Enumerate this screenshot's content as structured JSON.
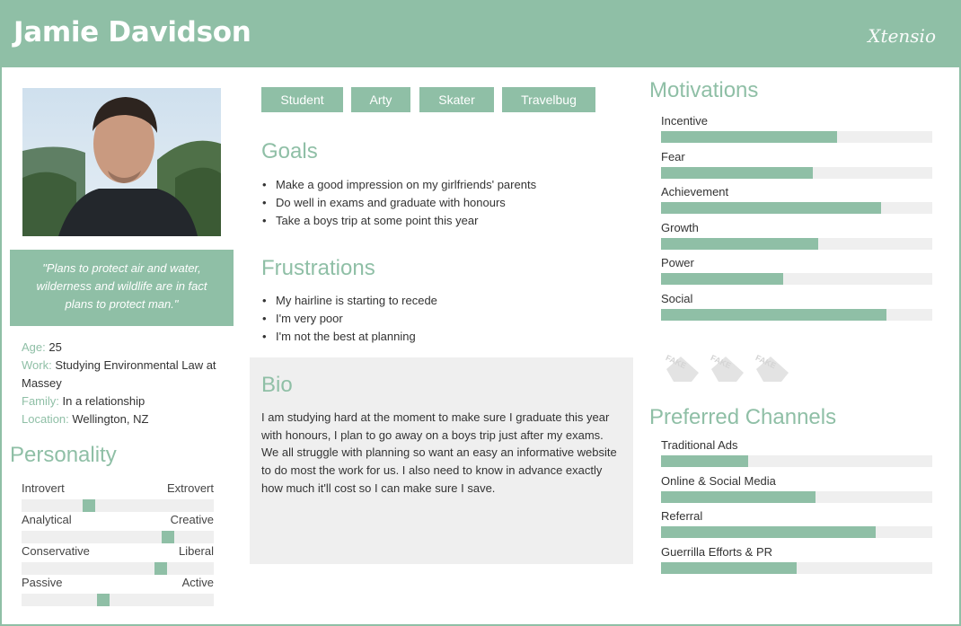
{
  "header": {
    "name": "Jamie Davidson",
    "brand": "Xtensio"
  },
  "quote": "\"Plans to protect air and water, wilderness and wildlife are in fact plans to protect man.\"",
  "facts": [
    {
      "key": "Age:",
      "value": " 25"
    },
    {
      "key": "Work:",
      "value": " Studying Environmental Law at Massey"
    },
    {
      "key": "Family:",
      "value": " In a relationship"
    },
    {
      "key": "Location:",
      "value": " Wellington, NZ"
    }
  ],
  "personality": {
    "title": "Personality",
    "traits": [
      {
        "left": "Introvert",
        "right": "Extrovert",
        "level": 0.34
      },
      {
        "left": "Analytical",
        "right": "Creative",
        "level": 0.78
      },
      {
        "left": "Conservative",
        "right": "Liberal",
        "level": 0.74
      },
      {
        "left": "Passive",
        "right": "Active",
        "level": 0.42
      }
    ]
  },
  "tags": [
    "Student",
    "Arty",
    "Skater",
    "Travelbug"
  ],
  "goals": {
    "title": "Goals",
    "items": [
      "Make a good impression on my girlfriends' parents",
      "Do well in exams and graduate with honours",
      "Take a boys trip at some point this year"
    ]
  },
  "frustrations": {
    "title": "Frustrations",
    "items": [
      "My hairline is starting to recede",
      "I'm very poor",
      "I'm not the best at planning"
    ]
  },
  "bio": {
    "title": "Bio",
    "text": "I am studying hard at the moment to make sure I graduate this year with honours, I plan to go away on a boys trip just after my exams. We all struggle with planning so want an easy an informative website to do most the work for us. I also need to know in advance exactly how much it'll cost so I can make sure I save."
  },
  "motivations": {
    "title": "Motivations",
    "items": [
      {
        "label": "Incentive",
        "value": 0.65
      },
      {
        "label": "Fear",
        "value": 0.56
      },
      {
        "label": "Achievement",
        "value": 0.81
      },
      {
        "label": "Growth",
        "value": 0.58
      },
      {
        "label": "Power",
        "value": 0.45
      },
      {
        "label": "Social",
        "value": 0.83
      }
    ]
  },
  "channels": {
    "title": "Preferred Channels",
    "items": [
      {
        "label": "Traditional Ads",
        "value": 0.32
      },
      {
        "label": "Online & Social Media",
        "value": 0.57
      },
      {
        "label": "Referral",
        "value": 0.79
      },
      {
        "label": "Guerrilla Efforts & PR",
        "value": 0.5
      }
    ]
  },
  "logos": {
    "text": "FAKE",
    "icon": "fake-brand-logo"
  },
  "colors": {
    "accent": "#8fbfa6",
    "panel": "#efefef"
  }
}
